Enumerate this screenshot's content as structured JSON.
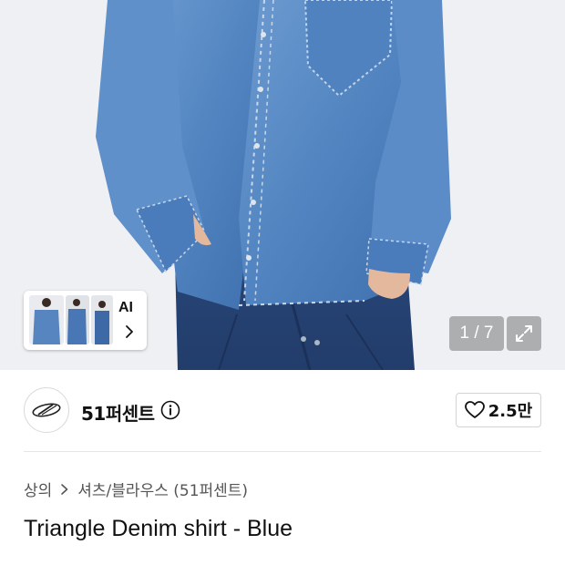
{
  "gallery": {
    "ai_label": "AI",
    "counter": "1 / 7",
    "thumbnail_count": 3
  },
  "brand": {
    "name": "51퍼센트",
    "likes": "2.5만"
  },
  "breadcrumb": {
    "items": [
      "상의",
      "셔츠/블라우스 (51퍼센트)"
    ]
  },
  "product": {
    "title": "Triangle Denim shirt - Blue"
  },
  "colors": {
    "denim_light": "#5b8fc9",
    "denim_dark": "#2d4f86",
    "background": "#eef0f3"
  },
  "icons": [
    "ai-thumbnails",
    "chevron-right-icon",
    "expand-icon",
    "brand-logo",
    "info-icon",
    "heart-icon"
  ]
}
